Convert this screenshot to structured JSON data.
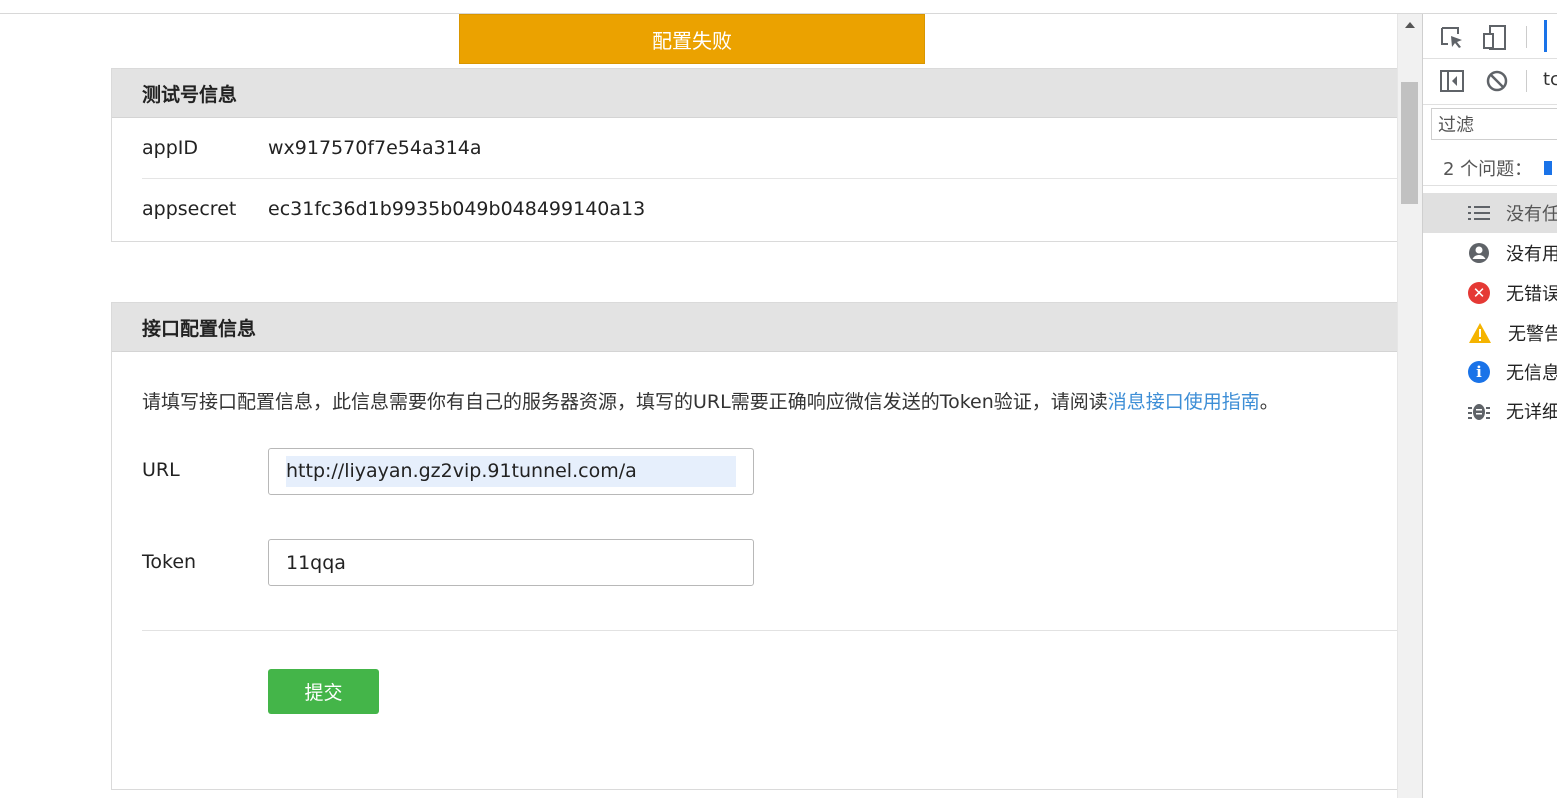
{
  "alert": {
    "text": "配置失败"
  },
  "test_info": {
    "title": "测试号信息",
    "rows": [
      {
        "label": "appID",
        "value": "wx917570f7e54a314a"
      },
      {
        "label": "appsecret",
        "value": "ec31fc36d1b9935b049b048499140a13"
      }
    ]
  },
  "api_config": {
    "title": "接口配置信息",
    "description": "请填写接口配置信息，此信息需要你有自己的服务器资源，填写的URL需要正确响应微信发送的Token验证，请阅读",
    "link_text": "消息接口使用指南",
    "description_end": "。",
    "url_label": "URL",
    "url_value": "http://liyayan.gz2vip.91tunnel.com/a",
    "token_label": "Token",
    "token_value": "11qqa",
    "submit_label": "提交"
  },
  "devtools": {
    "tab_partial": "tc",
    "filter_placeholder": "过滤",
    "issues_text": "2 个问题：",
    "items": [
      {
        "label": "没有任",
        "icon": "list-icon"
      },
      {
        "label": "没有用",
        "icon": "user-icon"
      },
      {
        "label": "无错误",
        "icon": "error-icon"
      },
      {
        "label": "无警告",
        "icon": "warning-icon"
      },
      {
        "label": "无信息",
        "icon": "info-icon"
      },
      {
        "label": "无详细",
        "icon": "bug-icon"
      }
    ],
    "colors": {
      "error": "#e53935",
      "warning": "#f5b400",
      "info": "#1a73e8",
      "icon_gray": "#5f6368"
    }
  }
}
